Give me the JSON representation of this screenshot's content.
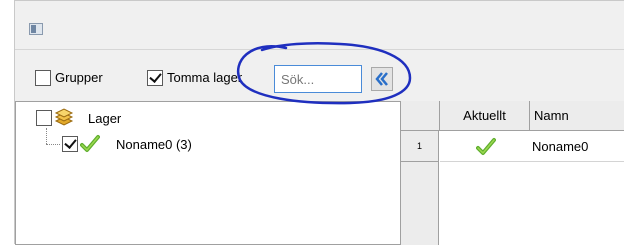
{
  "toolbar": {
    "group_label": "Grupper",
    "group_checked": false,
    "empty_storage_label": "Tomma lager",
    "empty_storage_checked": true,
    "search_placeholder": "Sök...",
    "search_value": ""
  },
  "tree": {
    "root": {
      "label": "Lager",
      "checked": false,
      "icon": "stack-icon"
    },
    "children": [
      {
        "label": "Noname0 (3)",
        "checked": true,
        "icon": "green-check-icon"
      }
    ]
  },
  "grid": {
    "columns": [
      "Aktuellt",
      "Namn"
    ],
    "rows": [
      {
        "row_number": "1",
        "current": true,
        "name": "Noname0"
      }
    ]
  },
  "annotation": {
    "color": "#1f2fbf",
    "shape": "hand-drawn-circle"
  }
}
